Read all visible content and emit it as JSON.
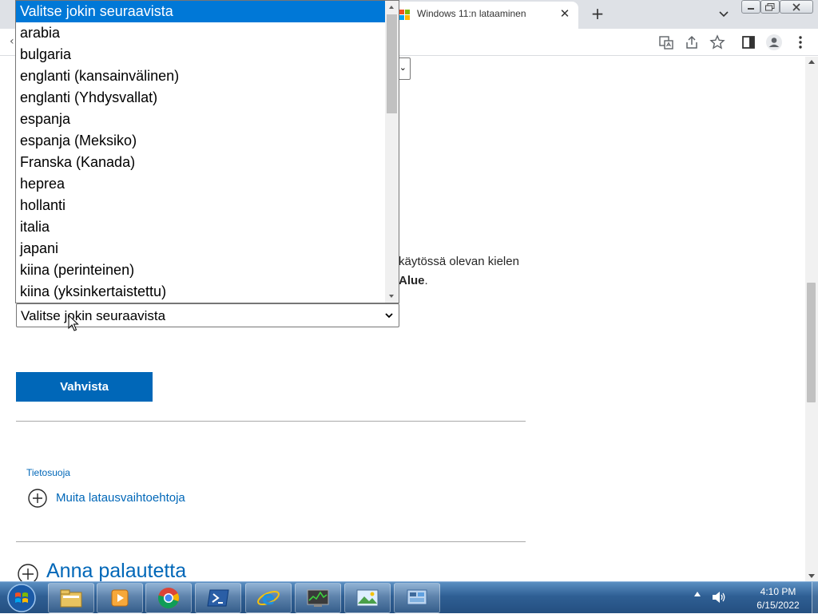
{
  "browser": {
    "tab_title": "Windows 11:n lataaminen",
    "tab_close": "✕",
    "new_tab": "+",
    "back_fragment": "‹"
  },
  "page": {
    "instruction_line1": "käytössä olevan kielen",
    "instruction_line2_bold": "Alue",
    "instruction_line2_end": ".",
    "language_select_value": "Valitse jokin seuraavista",
    "confirm_button": "Vahvista",
    "privacy_link": "Tietosuoja",
    "more_options": "Muita latausvaihtoehtoja",
    "feedback": "Anna palautetta"
  },
  "dropdown": {
    "options": [
      "Valitse jokin seuraavista",
      "arabia",
      "bulgaria",
      "englanti (kansainvälinen)",
      "englanti (Yhdysvallat)",
      "espanja",
      "espanja (Meksiko)",
      "Franska (Kanada)",
      "heprea",
      "hollanti",
      "italia",
      "japani",
      "kiina (perinteinen)",
      "kiina (yksinkertaistettu)"
    ],
    "selected_index": 0
  },
  "taskbar": {
    "time": "4:10 PM",
    "date": "6/15/2022",
    "pinned": [
      "explorer-icon",
      "media-player-icon",
      "chrome-icon",
      "powershell-icon",
      "internet-explorer-icon",
      "task-manager-icon",
      "photo-viewer-icon",
      "control-panel-icon"
    ]
  },
  "colors": {
    "accent": "#0067b8",
    "selection": "#0078d7",
    "taskbar": "#2f5f94"
  }
}
